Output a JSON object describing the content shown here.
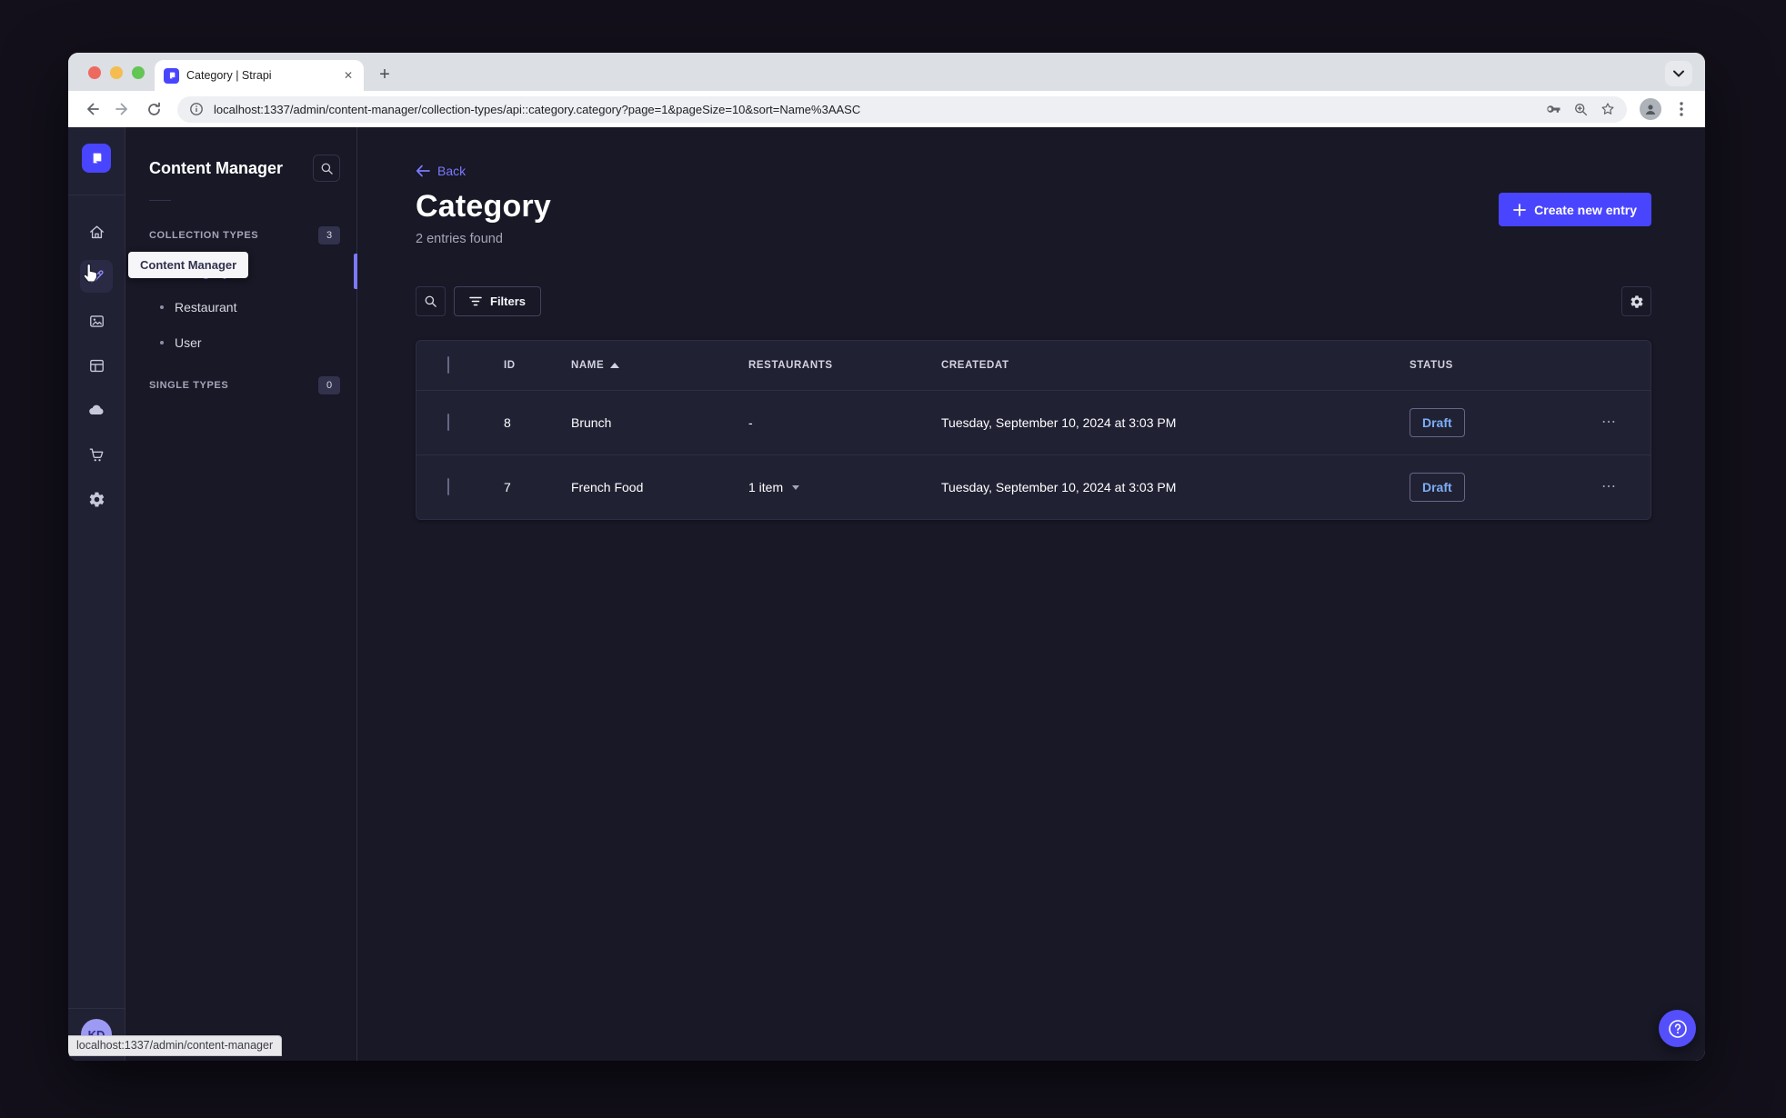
{
  "browser": {
    "tab_title": "Category | Strapi",
    "url": "localhost:1337/admin/content-manager/collection-types/api::category.category?page=1&pageSize=10&sort=Name%3AASC",
    "status_tooltip": "localhost:1337/admin/content-manager"
  },
  "glyphs": {
    "close": "✕",
    "new_tab": "+",
    "dots": "⋯",
    "plus": "+"
  },
  "nav": {
    "title": "Content Manager",
    "tooltip": "Content Manager",
    "sections": [
      {
        "label": "COLLECTION TYPES",
        "badge": "3"
      },
      {
        "label": "SINGLE TYPES",
        "badge": "0"
      }
    ],
    "items": [
      {
        "label": "Category"
      },
      {
        "label": "Restaurant"
      },
      {
        "label": "User"
      }
    ]
  },
  "header": {
    "back_label": "Back",
    "title": "Category",
    "subtitle": "2 entries found",
    "create_label": "Create new entry"
  },
  "toolbar": {
    "filters_label": "Filters"
  },
  "table": {
    "headers": [
      "ID",
      "NAME",
      "RESTAURANTS",
      "CREATEDAT",
      "STATUS"
    ],
    "rows": [
      {
        "id": "8",
        "name": "Brunch",
        "restaurants": "-",
        "created_at": "Tuesday, September 10, 2024 at 3:03 PM",
        "status": "Draft"
      },
      {
        "id": "7",
        "name": "French Food",
        "restaurants": "1 item",
        "created_at": "Tuesday, September 10, 2024 at 3:03 PM",
        "status": "Draft"
      }
    ]
  },
  "user": {
    "initials": "KD"
  },
  "colors": {
    "primary": "#4945ff",
    "link": "#7b79ff",
    "draft_text": "#7caef6",
    "app_bg": "#181826",
    "surface": "#212134"
  }
}
